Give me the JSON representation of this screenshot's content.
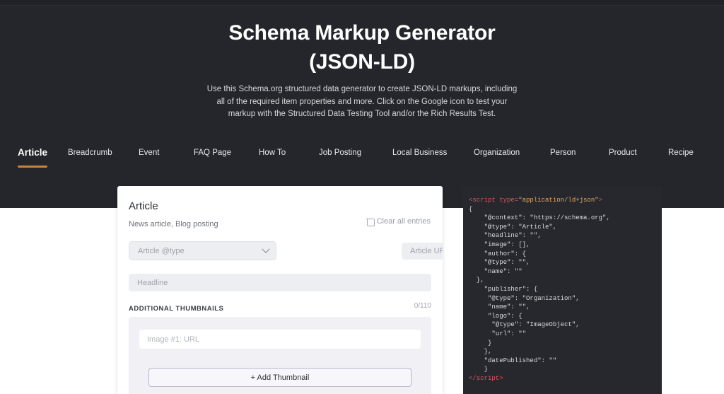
{
  "hero": {
    "title_line1": "Schema Markup Generator",
    "title_line2": "(JSON-LD)",
    "desc_line1": "Use this Schema.org structured data generator to create JSON-LD markups, including",
    "desc_line2": "all of the required item properties and more. Click on the Google icon to test your",
    "desc_line3": "markup with the Structured Data Testing Tool and/or the Rich Results Test."
  },
  "accent_color": "#c8833a",
  "tabs": [
    {
      "label": "Article",
      "active": true
    },
    {
      "label": "Breadcrumb",
      "active": false
    },
    {
      "label": "Event",
      "active": false
    },
    {
      "label": "FAQ Page",
      "active": false
    },
    {
      "label": "How To",
      "active": false
    },
    {
      "label": "Job Posting",
      "active": false
    },
    {
      "label": "Local Business",
      "active": false
    },
    {
      "label": "Organization",
      "active": false
    },
    {
      "label": "Person",
      "active": false
    },
    {
      "label": "Product",
      "active": false
    },
    {
      "label": "Recipe",
      "active": false
    }
  ],
  "card": {
    "title": "Article",
    "subtitle": "News article, Blog posting",
    "clear_all_label": "Clear all entries",
    "type_select_value": "Article @type",
    "url_placeholder": "Article URL",
    "url_value": "",
    "headline_placeholder": "Headline",
    "headline_value": "",
    "thumbnails_header": "ADDITIONAL THUMBNAILS",
    "counter": "0/110",
    "image1_placeholder": "Image #1: URL",
    "image1_value": "",
    "add_thumbnail_label": "+ Add Thumbnail"
  },
  "code": {
    "open_tag_a": "<script",
    "open_tag_b": " type=",
    "open_tag_c": "\"application/ld+json\"",
    "open_tag_d": ">",
    "close_tag": "</script>",
    "lines": [
      "{",
      "    \"@context\": \"https://schema.org\",",
      "    \"@type\": \"Article\",",
      "    \"headline\": \"\",",
      "    \"image\": [],",
      "    \"author\": {",
      "    \"@type\": \"\",",
      "    \"name\": \"\"",
      "  },",
      "    \"publisher\": {",
      "     \"@type\": \"Organization\",",
      "     \"name\": \"\",",
      "     \"logo\": {",
      "      \"@type\": \"ImageObject\",",
      "      \"url\": \"\"",
      "     }",
      "    },",
      "    \"datePublished\": \"\"",
      "    }"
    ]
  }
}
